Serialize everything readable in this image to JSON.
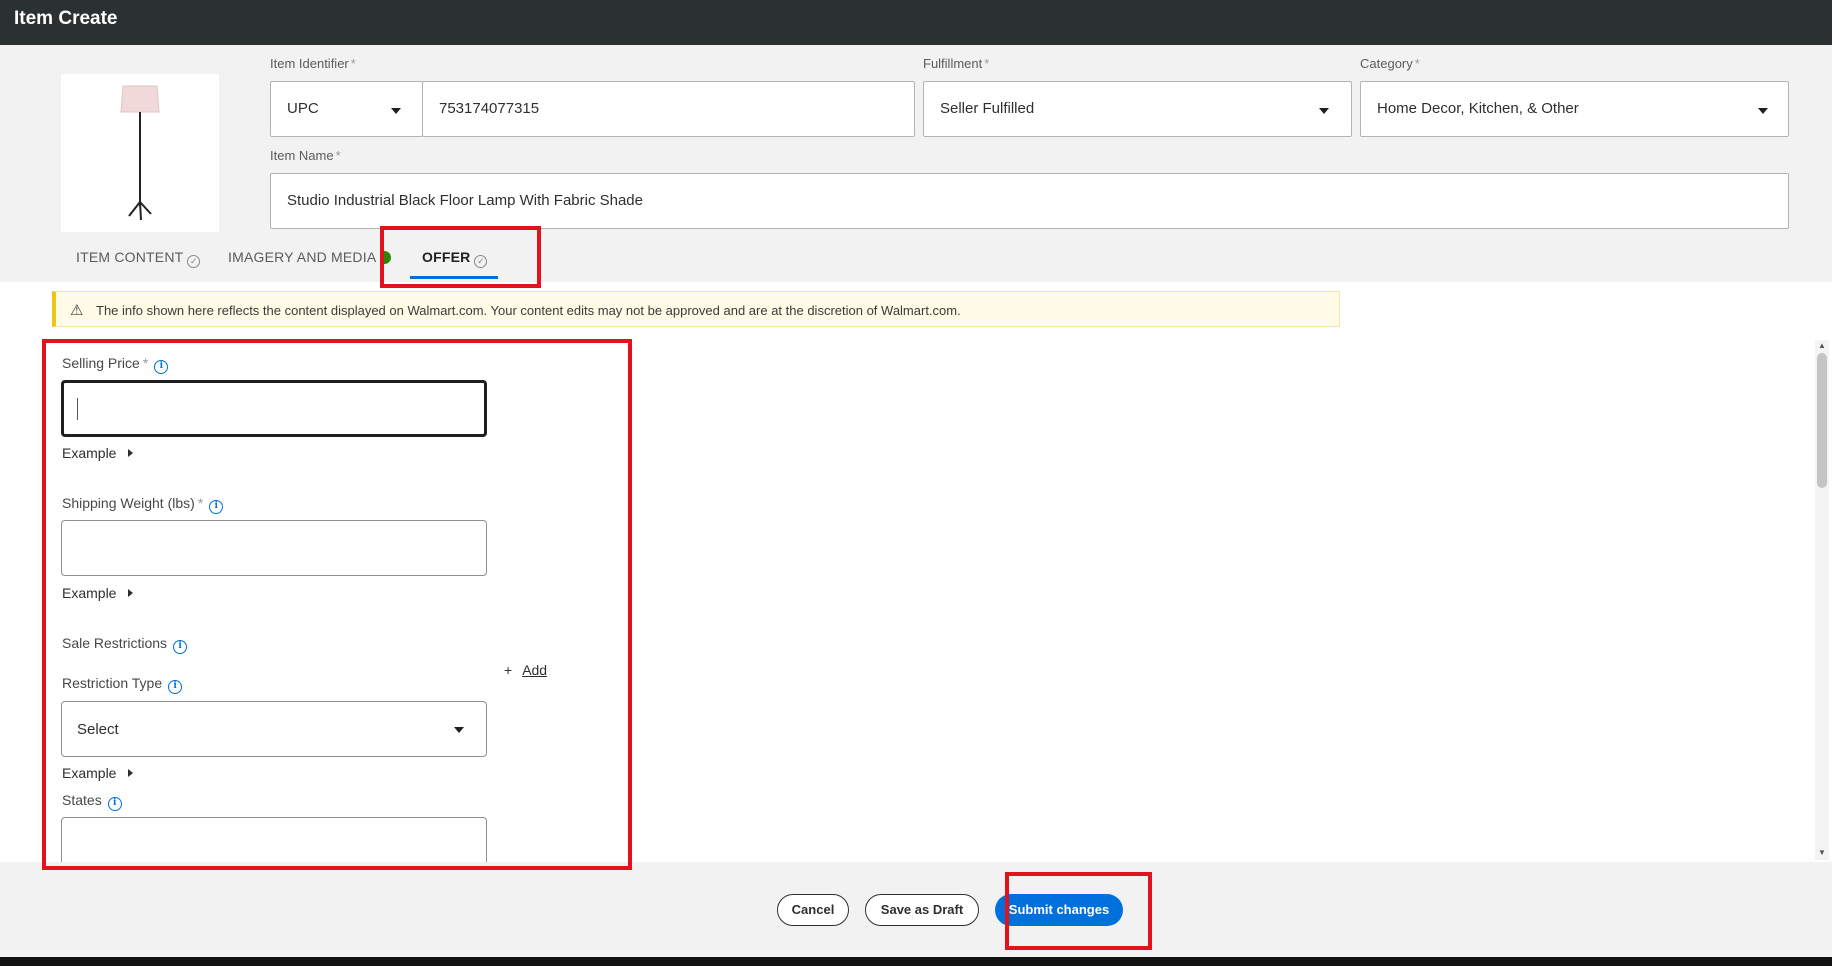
{
  "window": {
    "title": "Item Create"
  },
  "header": {
    "identifier": {
      "label": "Item Identifier",
      "type_value": "UPC",
      "value": "753174077315"
    },
    "fulfillment": {
      "label": "Fulfillment",
      "value": "Seller Fulfilled"
    },
    "category": {
      "label": "Category",
      "value": "Home Decor, Kitchen, & Other"
    },
    "item_name": {
      "label": "Item Name",
      "value": "Studio Industrial Black Floor Lamp With Fabric Shade"
    },
    "required_mark": "*"
  },
  "tabs": [
    {
      "label": "ITEM CONTENT",
      "status_icon": "check-circle-icon"
    },
    {
      "label": "IMAGERY AND MEDIA",
      "status_icon": "complete-dot-icon"
    },
    {
      "label": "OFFER",
      "status_icon": "check-circle-icon",
      "active": true
    }
  ],
  "banner": {
    "message": "The info shown here reflects the content displayed on Walmart.com. Your content edits may not be approved and are at the discretion of Walmart.com."
  },
  "form": {
    "selling_price": {
      "label": "Selling Price",
      "value": ""
    },
    "shipping_weight": {
      "label": "Shipping Weight (lbs)",
      "value": ""
    },
    "example_label": "Example",
    "sale_restrictions": {
      "label": "Sale Restrictions"
    },
    "restriction_type": {
      "label": "Restriction Type",
      "value": "Select"
    },
    "add_label": "Add",
    "states": {
      "label": "States",
      "value": ""
    }
  },
  "footer": {
    "cancel": "Cancel",
    "save_draft": "Save as Draft",
    "submit": "Submit changes"
  },
  "colors": {
    "titlebar": "#2b3031",
    "accent": "#0071dc",
    "annotation": "#e1141e",
    "banner_bg": "#fffbe6",
    "success": "#2a8703"
  }
}
